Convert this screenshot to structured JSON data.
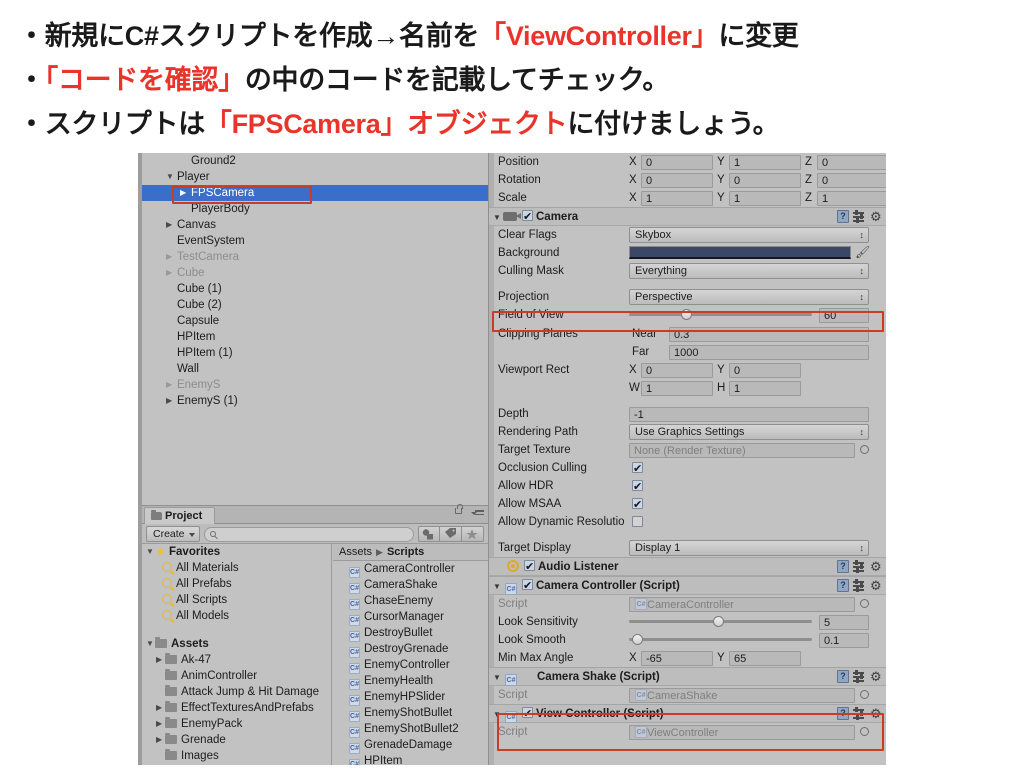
{
  "slide": {
    "lines": [
      [
        {
          "t": "・新規にC#スクリプトを作成→名前を",
          "c": "black"
        },
        {
          "t": "「ViewController」",
          "c": "red"
        },
        {
          "t": "に変更",
          "c": "black"
        }
      ],
      [
        {
          "t": "・",
          "c": "black"
        },
        {
          "t": "「コードを確認」",
          "c": "red"
        },
        {
          "t": "の中のコードを記載してチェック。",
          "c": "black"
        }
      ],
      [
        {
          "t": "・スクリプトは",
          "c": "black"
        },
        {
          "t": "「FPSCamera」オブジェクト",
          "c": "red"
        },
        {
          "t": "に付けましょう。",
          "c": "black"
        }
      ]
    ],
    "accent_color": "#e8342a"
  },
  "hierarchy": {
    "items": [
      {
        "label": "Ground2",
        "indent": 2,
        "arrow": "none",
        "state": "normal"
      },
      {
        "label": "Player",
        "indent": 1,
        "arrow": "open",
        "state": "normal"
      },
      {
        "label": "FPSCamera",
        "indent": 2,
        "arrow": "closed",
        "state": "selected"
      },
      {
        "label": "PlayerBody",
        "indent": 2,
        "arrow": "none",
        "state": "normal"
      },
      {
        "label": "Canvas",
        "indent": 1,
        "arrow": "closed",
        "state": "normal"
      },
      {
        "label": "EventSystem",
        "indent": 1,
        "arrow": "none",
        "state": "normal"
      },
      {
        "label": "TestCamera",
        "indent": 1,
        "arrow": "none",
        "state": "dim"
      },
      {
        "label": "Cube",
        "indent": 1,
        "arrow": "closed",
        "state": "dim"
      },
      {
        "label": "Cube (1)",
        "indent": 1,
        "arrow": "none",
        "state": "normal"
      },
      {
        "label": "Cube (2)",
        "indent": 1,
        "arrow": "none",
        "state": "normal"
      },
      {
        "label": "Capsule",
        "indent": 1,
        "arrow": "none",
        "state": "normal"
      },
      {
        "label": "HPItem",
        "indent": 1,
        "arrow": "none",
        "state": "normal"
      },
      {
        "label": "HPItem (1)",
        "indent": 1,
        "arrow": "none",
        "state": "normal"
      },
      {
        "label": "Wall",
        "indent": 1,
        "arrow": "none",
        "state": "normal"
      },
      {
        "label": "EnemyS",
        "indent": 1,
        "arrow": "closed",
        "state": "dim"
      },
      {
        "label": "EnemyS (1)",
        "indent": 1,
        "arrow": "closed",
        "state": "normal"
      }
    ],
    "selection_highlight_color": "#c93d23"
  },
  "project": {
    "tab_label": "Project",
    "create_label": "Create",
    "search_placeholder": "",
    "favorites": {
      "label": "Favorites",
      "items": [
        "All Materials",
        "All Prefabs",
        "All Scripts",
        "All Models"
      ]
    },
    "assets": {
      "label": "Assets",
      "items": [
        {
          "label": "Ak-47",
          "arrow": "closed"
        },
        {
          "label": "AnimController",
          "arrow": "none"
        },
        {
          "label": "Attack Jump & Hit Damage",
          "arrow": "none"
        },
        {
          "label": "EffectTexturesAndPrefabs",
          "arrow": "closed"
        },
        {
          "label": "EnemyPack",
          "arrow": "closed"
        },
        {
          "label": "Grenade",
          "arrow": "closed"
        },
        {
          "label": "Images",
          "arrow": "none"
        }
      ]
    },
    "breadcrumb": {
      "root": "Assets",
      "current": "Scripts"
    },
    "script_files": [
      "CameraController",
      "CameraShake",
      "ChaseEnemy",
      "CursorManager",
      "DestroyBullet",
      "DestroyGrenade",
      "EnemyController",
      "EnemyHealth",
      "EnemyHPSlider",
      "EnemyShotBullet",
      "EnemyShotBullet2",
      "GrenadeDamage",
      "HPItem"
    ]
  },
  "inspector": {
    "transform": {
      "rows": [
        {
          "label": "Position",
          "x": "0",
          "y": "1",
          "z": "0"
        },
        {
          "label": "Rotation",
          "x": "0",
          "y": "0",
          "z": "0"
        },
        {
          "label": "Scale",
          "x": "1",
          "y": "1",
          "z": "1"
        }
      ],
      "axis_labels": [
        "X",
        "Y",
        "Z"
      ]
    },
    "camera": {
      "title": "Camera",
      "enabled": true,
      "clear_flags": {
        "label": "Clear Flags",
        "value": "Skybox"
      },
      "background": {
        "label": "Background",
        "color": "#3b4766"
      },
      "culling_mask": {
        "label": "Culling Mask",
        "value": "Everything"
      },
      "projection": {
        "label": "Projection",
        "value": "Perspective"
      },
      "field_of_view": {
        "label": "Field of View",
        "value": "60",
        "slider_pct": 30
      },
      "clipping_planes": {
        "label": "Clipping Planes",
        "near_label": "Near",
        "near": "0.3",
        "far_label": "Far",
        "far": "1000"
      },
      "viewport_rect": {
        "label": "Viewport Rect",
        "x": "0",
        "y": "0",
        "w": "1",
        "h": "1",
        "x_label": "X",
        "y_label": "Y",
        "w_label": "W",
        "h_label": "H"
      },
      "depth": {
        "label": "Depth",
        "value": "-1"
      },
      "rendering_path": {
        "label": "Rendering Path",
        "value": "Use Graphics Settings"
      },
      "target_texture": {
        "label": "Target Texture",
        "value": "None (Render Texture)"
      },
      "occlusion_culling": {
        "label": "Occlusion Culling",
        "checked": true
      },
      "allow_hdr": {
        "label": "Allow HDR",
        "checked": true
      },
      "allow_msaa": {
        "label": "Allow MSAA",
        "checked": true
      },
      "allow_dynamic_resolution": {
        "label": "Allow Dynamic Resolutio",
        "checked": false
      },
      "target_display": {
        "label": "Target Display",
        "value": "Display 1"
      }
    },
    "audio_listener": {
      "title": "Audio Listener",
      "enabled": true
    },
    "camera_controller": {
      "title": "Camera Controller (Script)",
      "enabled": true,
      "script": {
        "label": "Script",
        "value": "CameraController"
      },
      "look_sensitivity": {
        "label": "Look Sensitivity",
        "value": "5",
        "slider_pct": 49
      },
      "look_smooth": {
        "label": "Look Smooth",
        "value": "0.1",
        "slider_pct": 2
      },
      "min_max_angle": {
        "label": "Min Max Angle",
        "x_label": "X",
        "x": "-65",
        "y_label": "Y",
        "y": "65"
      }
    },
    "camera_shake": {
      "title": "Camera Shake (Script)",
      "enabled": null,
      "script": {
        "label": "Script",
        "value": "CameraShake"
      }
    },
    "view_controller": {
      "title": "View Controller (Script)",
      "enabled": true,
      "script": {
        "label": "Script",
        "value": "ViewController"
      },
      "highlight_color": "#c93d23"
    }
  }
}
